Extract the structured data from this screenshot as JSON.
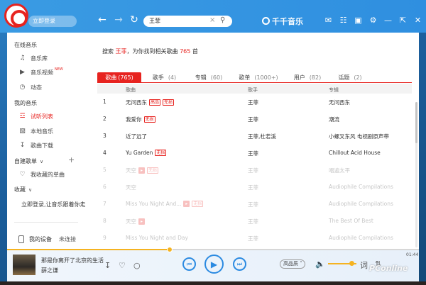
{
  "header": {
    "login": "立即登录",
    "search_query": "王菲",
    "brand": "千千音乐"
  },
  "sidebar": {
    "sections": [
      {
        "title": "在线音乐"
      },
      {
        "title": "我的音乐"
      },
      {
        "title": "自建歌单"
      },
      {
        "title": "收藏"
      }
    ],
    "online_items": [
      "音乐库",
      "音乐视频",
      "动态"
    ],
    "new_badge": "NEW",
    "my_items": [
      "试听列表",
      "本地音乐",
      "歌曲下载"
    ],
    "playlist_items": [
      "我收藏的单曲"
    ],
    "promo": "立即登录,让音乐跟着你走",
    "device": "我的设备",
    "device_status": "未连接"
  },
  "main": {
    "result_prefix": "搜索",
    "result_query": "王菲",
    "result_mid": "，为你找到相关歌曲",
    "result_count": "765",
    "result_suffix": "首",
    "tabs": [
      {
        "label": "歌曲",
        "count": "(765)"
      },
      {
        "label": "歌手",
        "count": "(4)"
      },
      {
        "label": "专辑",
        "count": "(60)"
      },
      {
        "label": "歌单",
        "count": "(1000+)"
      },
      {
        "label": "用户",
        "count": "(82)"
      },
      {
        "label": "话题",
        "count": "(2)"
      }
    ],
    "columns": [
      "歌曲",
      "歌手",
      "专辑"
    ],
    "tag_labels": {
      "hifi": "高品",
      "lossless": "无损"
    },
    "rows": [
      {
        "num": "1",
        "song": "无问西东",
        "artist": "王菲",
        "album": "无问西东"
      },
      {
        "num": "2",
        "song": "我爱你",
        "artist": "王菲",
        "album": "潮流"
      },
      {
        "num": "3",
        "song": "近了远了",
        "artist": "王菲,杜若溪",
        "album": "小螺叉东风 电视剧原声带"
      },
      {
        "num": "4",
        "song": "Yu Garden",
        "artist": "王菲",
        "album": "Chillout Acid House"
      },
      {
        "num": "5",
        "song": "天空",
        "artist": "王菲",
        "album": "唱遍太平"
      },
      {
        "num": "6",
        "song": "天空",
        "artist": "王菲",
        "album": "Audiophile Compilations"
      },
      {
        "num": "7",
        "song": "Miss You Night And...",
        "artist": "王菲",
        "album": "Audiophile Compilations"
      },
      {
        "num": "8",
        "song": "天空",
        "artist": "王菲",
        "album": "The Best Of Best"
      },
      {
        "num": "9",
        "song": "Miss You Night and Day",
        "artist": "王菲",
        "album": "Audiophile Compilations"
      }
    ]
  },
  "player": {
    "song": "那是你离开了北京的生活",
    "artist": "薛之谦",
    "quality": "高品质",
    "time": "01:44",
    "progress": 0.395,
    "volume": 0.75
  },
  "watermark": "PConline",
  "colors": {
    "accent": "#e7231f",
    "header": "#3a9be3",
    "control": "#2b8ae1",
    "progress": "#f5b321"
  }
}
